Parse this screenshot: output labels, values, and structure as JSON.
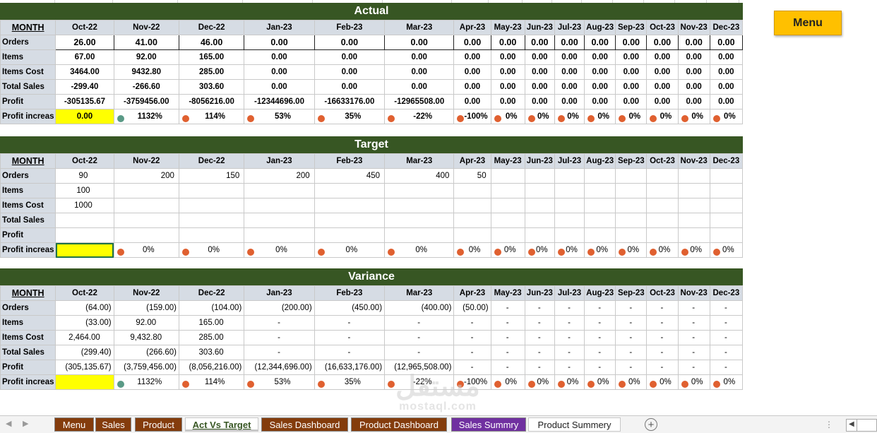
{
  "months": [
    "Oct-22",
    "Nov-22",
    "Dec-22",
    "Jan-23",
    "Feb-23",
    "Mar-23",
    "Apr-23",
    "May-23",
    "Jun-23",
    "Jul-23",
    "Aug-23",
    "Sep-23",
    "Oct-23",
    "Nov-23",
    "Dec-23"
  ],
  "month_header": "MONTH",
  "row_labels": [
    "Orders",
    "Items",
    "Items Cost",
    "Total Sales",
    "Profit",
    "Profit increas"
  ],
  "menu_button": "Menu",
  "actual": {
    "title": "Actual",
    "orders": [
      "26.00",
      "41.00",
      "46.00",
      "0.00",
      "0.00",
      "0.00",
      "0.00",
      "0.00",
      "0.00",
      "0.00",
      "0.00",
      "0.00",
      "0.00",
      "0.00",
      "0.00"
    ],
    "items": [
      "67.00",
      "92.00",
      "165.00",
      "0.00",
      "0.00",
      "0.00",
      "0.00",
      "0.00",
      "0.00",
      "0.00",
      "0.00",
      "0.00",
      "0.00",
      "0.00",
      "0.00"
    ],
    "items_cost": [
      "3464.00",
      "9432.80",
      "285.00",
      "0.00",
      "0.00",
      "0.00",
      "0.00",
      "0.00",
      "0.00",
      "0.00",
      "0.00",
      "0.00",
      "0.00",
      "0.00",
      "0.00"
    ],
    "total_sales": [
      "-299.40",
      "-266.60",
      "303.60",
      "0.00",
      "0.00",
      "0.00",
      "0.00",
      "0.00",
      "0.00",
      "0.00",
      "0.00",
      "0.00",
      "0.00",
      "0.00",
      "0.00"
    ],
    "profit": [
      "-305135.67",
      "-3759456.00",
      "-8056216.00",
      "-12344696.00",
      "-16633176.00",
      "-12965508.00",
      "0.00",
      "0.00",
      "0.00",
      "0.00",
      "0.00",
      "0.00",
      "0.00",
      "0.00",
      "0.00"
    ],
    "profit_increase_first": "0.00",
    "profit_increase": [
      "1132%",
      "114%",
      "53%",
      "35%",
      "-22%",
      "-100%",
      "0%",
      "0%",
      "0%",
      "0%",
      "0%",
      "0%",
      "0%",
      "0%"
    ]
  },
  "target": {
    "title": "Target",
    "orders": [
      "90",
      "200",
      "150",
      "200",
      "450",
      "400",
      "50",
      "",
      "",
      "",
      "",
      "",
      "",
      "",
      ""
    ],
    "items": [
      "100",
      "",
      "",
      "",
      "",
      "",
      "",
      "",
      "",
      "",
      "",
      "",
      "",
      "",
      ""
    ],
    "items_cost": [
      "1000",
      "",
      "",
      "",
      "",
      "",
      "",
      "",
      "",
      "",
      "",
      "",
      "",
      "",
      ""
    ],
    "total_sales": [
      "",
      "",
      "",
      "",
      "",
      "",
      "",
      "",
      "",
      "",
      "",
      "",
      "",
      "",
      ""
    ],
    "profit": [
      "",
      "",
      "",
      "",
      "",
      "",
      "",
      "",
      "",
      "",
      "",
      "",
      "",
      "",
      ""
    ],
    "profit_increase_first": "",
    "profit_increase": [
      "0%",
      "0%",
      "0%",
      "0%",
      "0%",
      "0%",
      "0%",
      "0%",
      "0%",
      "0%",
      "0%",
      "0%",
      "0%",
      "0%"
    ]
  },
  "variance": {
    "title": "Variance",
    "orders": [
      "(64.00)",
      "(159.00)",
      "(104.00)",
      "(200.00)",
      "(450.00)",
      "(400.00)",
      "(50.00)",
      "-",
      "-",
      "-",
      "-",
      "-",
      "-",
      "-",
      "-"
    ],
    "items": [
      "(33.00)",
      "92.00",
      "165.00",
      "-",
      "-",
      "-",
      "-",
      "-",
      "-",
      "-",
      "-",
      "-",
      "-",
      "-",
      "-"
    ],
    "items_cost": [
      "2,464.00",
      "9,432.80",
      "285.00",
      "-",
      "-",
      "-",
      "-",
      "-",
      "-",
      "-",
      "-",
      "-",
      "-",
      "-",
      "-"
    ],
    "total_sales": [
      "(299.40)",
      "(266.60)",
      "303.60",
      "-",
      "-",
      "-",
      "-",
      "-",
      "-",
      "-",
      "-",
      "-",
      "-",
      "-",
      "-"
    ],
    "profit": [
      "(305,135.67)",
      "(3,759,456.00)",
      "(8,056,216.00)",
      "(12,344,696.00)",
      "(16,633,176.00)",
      "(12,965,508.00)",
      "-",
      "-",
      "-",
      "-",
      "-",
      "-",
      "-",
      "-",
      "-"
    ],
    "profit_increase_first": "",
    "profit_increase": [
      "1132%",
      "114%",
      "53%",
      "35%",
      "-22%",
      "-100%",
      "0%",
      "0%",
      "0%",
      "0%",
      "0%",
      "0%",
      "0%",
      "0%"
    ]
  },
  "watermark": {
    "line1": "مستقل",
    "line2": "mostaql.com"
  },
  "sheet_tabs": [
    {
      "label": "Menu",
      "style": "brown"
    },
    {
      "label": "Sales",
      "style": "brown"
    },
    {
      "label": "Product",
      "style": "brown"
    },
    {
      "label": "Act Vs Target",
      "style": "active"
    },
    {
      "label": "Sales Dashboard",
      "style": "brown"
    },
    {
      "label": "Product Dashboard",
      "style": "brown"
    },
    {
      "label": "Sales Summry",
      "style": "purple"
    },
    {
      "label": "Product Summery",
      "style": "white"
    }
  ],
  "icons": {
    "add_sheet": "plus-circle-icon",
    "scroll_left": "caret-left-icon"
  },
  "colors": {
    "banner": "#375623",
    "header": "#d6dce4",
    "highlight": "#ffff00",
    "menu_button": "#ffc000",
    "indicator_red": "#e06030",
    "indicator_green": "#5a9a86",
    "tab_brown": "#843c0c",
    "tab_purple": "#7030a0"
  }
}
